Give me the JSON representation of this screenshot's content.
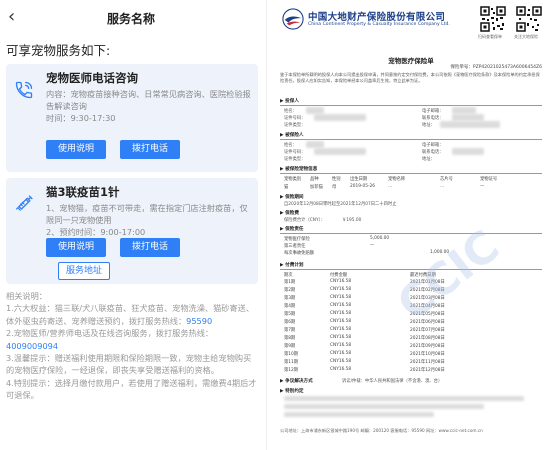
{
  "app": {
    "nav_title": "服务名称",
    "section_title": "可享宠物服务如下:"
  },
  "cards": [
    {
      "title": "宠物医师电话咨询",
      "desc": "内容：宠物疫苗接种咨询、日常常见病咨询、医院检验报告解读咨询",
      "time": "时间：9:30-17:30",
      "btn_primary": "使用说明",
      "btn_secondary": "拨打电话"
    },
    {
      "title": "猫3联疫苗1针",
      "desc1": "1、宠物猫，疫苗不可带走，需在指定门店注射疫苗，仅限同一只宠物使用",
      "desc2": "2、预约时间：9:00-17:00",
      "btn_primary": "使用说明",
      "btn_secondary": "拨打电话",
      "btn_outline": "服务地址"
    }
  ],
  "notes": {
    "heading": "相关说明：",
    "n1": "1.六大权益：猫三联/犬八联疫苗、狂犬疫苗、宠物洗澡、猫砂寄送、体外驱虫药寄送、宠养赠送预约，拨打服务热线：",
    "n1_phone": "95590",
    "n2a": "2.宠物医师/营养师电话及在线咨询服务，拨打服务热线：",
    "n2_phone": "4009009094",
    "n3": "3.温馨提示：赠送福利使用期限和保险期限一致，宠物主给宠物购买的宠物医疗保险，一经退保，即丧失享受赠送福利的资格。",
    "n4": "4.特别提示：选择月缴付款用户，若使用了赠送福利，需缴费4期后才可退保。"
  },
  "policy": {
    "company_cn": "中国大地财产保险股份有限公司",
    "company_en": "China Continent Property & Casualty Insurance Company Ltd.",
    "qr1_caption": "扫码查看保单",
    "qr2_caption": "关注大地保险",
    "title": "宠物医疗保险单",
    "policy_no": "保险单号：PZP42021025473A6006454Z6",
    "intro": "鉴于本保险单所载明的投保人向本公司提出投保申请，并同意按约定交付保险费，本公司依照《宠物医疗保险条款》及本保险单的约定承担保险责任。投保人应如实告知，本保险单经本公司盖章后生效，特立此单为证。",
    "sec_holder": "▶ 投保人",
    "sec_insured": "▶ 被保险人",
    "sec_pet": "▶ 被保险宠物信息",
    "sec_period": "▶ 保险期间",
    "sec_premium": "▶ 保险费",
    "sec_coverage": "▶ 保险责任",
    "sec_pay": "▶ 付费计划",
    "sec_dispute": "▶ 争议解决方式",
    "sec_special": "▶ 特别约定",
    "f_name": "姓名：",
    "f_id": "证件号码：",
    "f_phone": "电子邮箱：",
    "f_mobile": "联系电话：",
    "f_addr": "地址：",
    "f_cert": "证件类型：",
    "pet_cols": [
      "宠物类别",
      "品种",
      "性别",
      "出生日期",
      "宠物名称",
      "芯片号",
      "宠物证号"
    ],
    "pet_row": [
      "猫",
      "加菲猫",
      "母",
      "2019-05-26",
      "…",
      "…",
      "—"
    ],
    "period": "自2020年12月08日零时起至2021年12月07日二十四时止",
    "premium": "保险费合计（CNY）：",
    "premium_val": "￥195.00",
    "coverage_rows": [
      {
        "name": "宠物医疗保险",
        "limit": "5,000.00"
      },
      {
        "name": "第三者责任",
        "limit": "—"
      },
      {
        "name": "每次事故免赔额",
        "limit": "1,000.00"
      }
    ],
    "pay_head": [
      "期次",
      "付费金额",
      "最迟付费日期"
    ],
    "pay_rows": [
      [
        "第1期",
        "CNY16.58",
        "2021年01月08日"
      ],
      [
        "第2期",
        "CNY16.58",
        "2021年02月08日"
      ],
      [
        "第3期",
        "CNY16.58",
        "2021年03月08日"
      ],
      [
        "第4期",
        "CNY16.58",
        "2021年04月08日"
      ],
      [
        "第5期",
        "CNY16.58",
        "2021年05月08日"
      ],
      [
        "第6期",
        "CNY16.58",
        "2021年06月08日"
      ],
      [
        "第7期",
        "CNY16.58",
        "2021年07月08日"
      ],
      [
        "第8期",
        "CNY16.58",
        "2021年08月08日"
      ],
      [
        "第9期",
        "CNY16.58",
        "2021年09月08日"
      ],
      [
        "第10期",
        "CNY16.58",
        "2021年10月08日"
      ],
      [
        "第11期",
        "CNY16.58",
        "2021年11月08日"
      ],
      [
        "第12期",
        "CNY16.58",
        "2021年12月08日"
      ]
    ],
    "dispute": "诉讼/仲裁：中华人民共和国法律（不含港、澳、台）",
    "footer": "公司地址：上海市浦东新区银城中路190号  邮编：200120  客服电话：95590  网址：www.ccic-net.com.cn"
  }
}
